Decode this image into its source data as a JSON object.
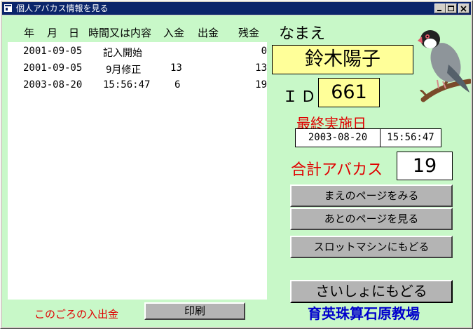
{
  "window": {
    "title": "個人アバカス情報を見る",
    "controls": [
      "minimize",
      "maximize",
      "close"
    ]
  },
  "table": {
    "headers": {
      "year": "年",
      "month": "月",
      "day": "日",
      "time_or_content": "時間又は内容",
      "deposit": "入金",
      "withdrawal": "出金",
      "balance": "残金"
    },
    "rows": [
      {
        "date": "2001-09-05",
        "content": "記入開始",
        "deposit": "",
        "withdrawal": "",
        "balance": "0"
      },
      {
        "date": "2001-09-05",
        "content": "9月修正",
        "deposit": "13",
        "withdrawal": "",
        "balance": "13"
      },
      {
        "date": "2003-08-20",
        "content": "15:56:47",
        "deposit": "6",
        "withdrawal": "",
        "balance": "19"
      }
    ]
  },
  "profile": {
    "name_label": "なまえ",
    "name": "鈴木陽子",
    "id_label": "ＩＤ",
    "id": "661",
    "last_label": "最終実施日",
    "last_date": "2003-08-20",
    "last_time": "15:56:47",
    "total_label": "合計アバカス",
    "total": "19"
  },
  "buttons": {
    "prev_page": "まえのページをみる",
    "next_page": "あとのページを見る",
    "slot": "スロットマシンにもどる",
    "start": "さいしょにもどる",
    "print": "印刷"
  },
  "footer": {
    "recent_label": "このごろの入出金",
    "school": "育英珠算石原教場"
  },
  "colors": {
    "client_bg": "#c8f8c8",
    "name_bg": "#ffff99",
    "accent_red": "#e00000",
    "school_blue": "#0000cc",
    "titlebar": "#0a246a"
  },
  "icons": [
    "window-app-icon",
    "minimize-icon",
    "maximize-icon",
    "close-icon",
    "java-sparrow-bird-icon"
  ]
}
